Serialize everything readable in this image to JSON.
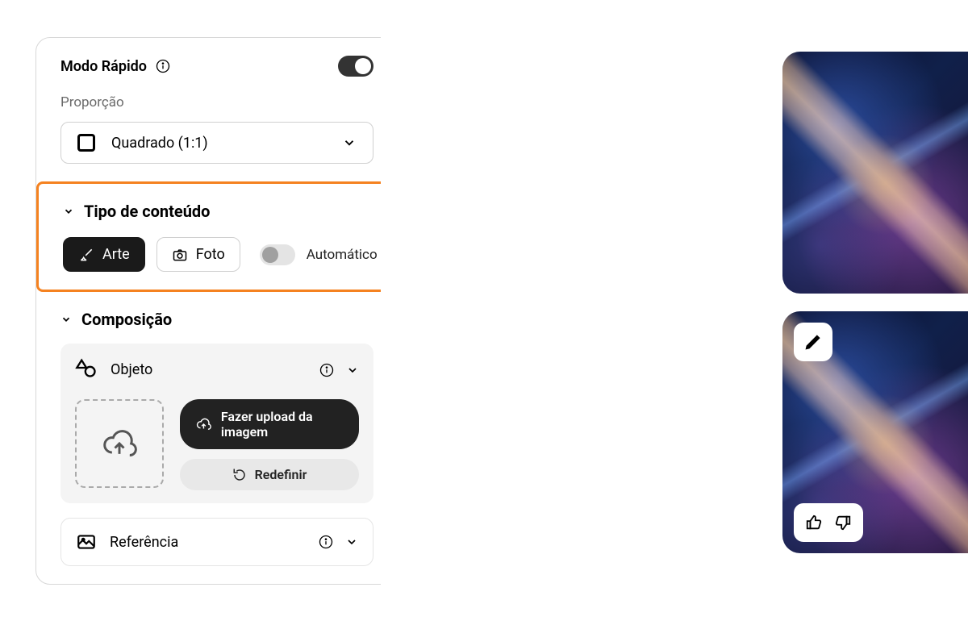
{
  "quick_mode": {
    "label": "Modo Rápido",
    "enabled": true
  },
  "ratio": {
    "heading": "Proporção",
    "value": "Quadrado (1:1)"
  },
  "content_type": {
    "heading": "Tipo de conteúdo",
    "art_label": "Arte",
    "photo_label": "Foto",
    "auto_label": "Automático",
    "auto_enabled": false,
    "selected": "art"
  },
  "composition": {
    "heading": "Composição",
    "object": {
      "label": "Objeto",
      "upload_label": "Fazer upload da imagem",
      "reset_label": "Redefinir"
    },
    "reference": {
      "label": "Referência"
    }
  },
  "icons": {
    "info": "info-icon",
    "chevron_down": "chevron-down-icon",
    "brush": "brush-icon",
    "camera": "camera-icon",
    "shapes": "shapes-icon",
    "upload": "cloud-upload-icon",
    "reset": "reset-icon",
    "image_ref": "image-ref-icon",
    "pencil": "pencil-icon",
    "thumbs_up": "thumbs-up-icon",
    "thumbs_down": "thumbs-down-icon"
  }
}
